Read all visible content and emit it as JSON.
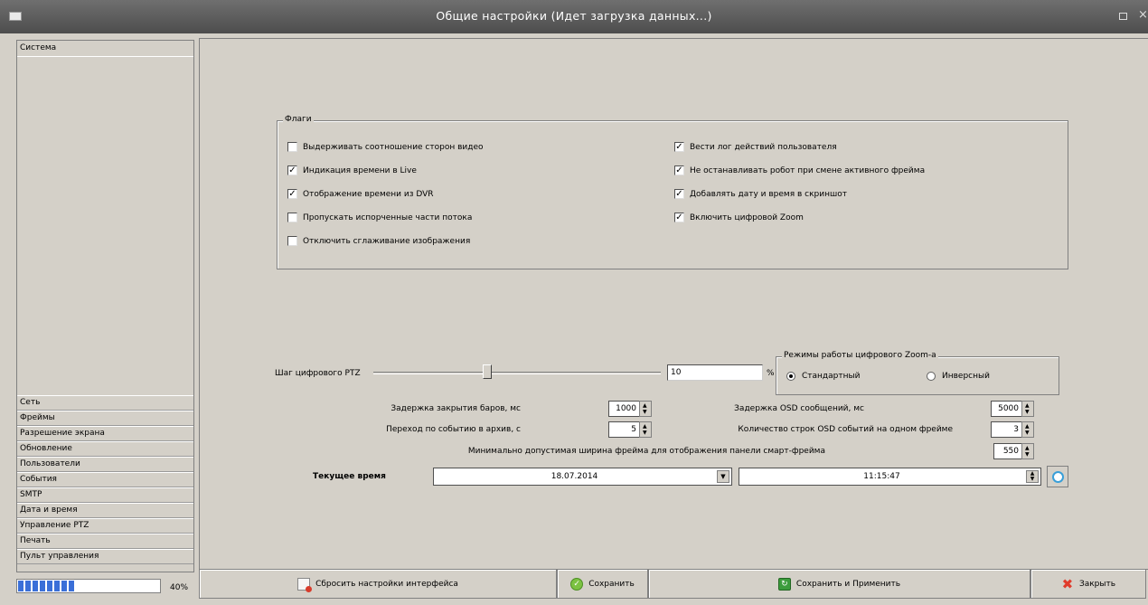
{
  "window": {
    "title": "Общие настройки (Идет загрузка данных...)"
  },
  "sidebar": {
    "active_item": "Система",
    "items": [
      "Сеть",
      "Фреймы",
      "Разрешение экрана",
      "Обновление",
      "Пользователи",
      "События",
      "SMTP",
      "Дата и время",
      "Управление PTZ",
      "Печать",
      "Пульт управления"
    ]
  },
  "progress": {
    "value": 0.4,
    "label": "40%"
  },
  "flags": {
    "legend": "Флаги",
    "left": [
      {
        "label": "Выдерживать соотношение сторон видео",
        "checked": false
      },
      {
        "label": "Индикация времени в Live",
        "checked": true
      },
      {
        "label": "Отображение времени из DVR",
        "checked": true
      },
      {
        "label": "Пропускать испорченные части потока",
        "checked": false
      },
      {
        "label": "Отключить сглаживание изображения",
        "checked": false
      }
    ],
    "right": [
      {
        "label": "Вести лог действий пользователя",
        "checked": true
      },
      {
        "label": "Не останавливать робот при смене активного фрейма",
        "checked": true
      },
      {
        "label": "Добавлять дату и время в скриншот",
        "checked": true
      },
      {
        "label": "Включить цифровой Zoom",
        "checked": true
      }
    ]
  },
  "ptz": {
    "label": "Шаг цифрового PTZ",
    "value": "10",
    "unit": "%",
    "slider_fraction": 0.38
  },
  "zoom_mode": {
    "legend": "Режимы работы цифрового Zoom-а",
    "options": [
      {
        "label": "Стандартный",
        "selected": true
      },
      {
        "label": "Инверсный",
        "selected": false
      }
    ]
  },
  "fields": {
    "bars_close_delay": {
      "label": "Задержка закрытия баров, мс",
      "value": "1000"
    },
    "osd_delay": {
      "label": "Задержка OSD  сообщений, мс",
      "value": "5000"
    },
    "archive_jump": {
      "label": "Переход по событию в архив, с",
      "value": "5"
    },
    "osd_lines": {
      "label": "Количество строк OSD событий на одном фрейме",
      "value": "3"
    },
    "min_frame_width": {
      "label": "Минимально допустимая ширина фрейма для отображения панели смарт-фрейма",
      "value": "550"
    }
  },
  "current_time": {
    "label": "Текущее время",
    "date": "18.07.2014",
    "time": "11:15:47"
  },
  "buttons": {
    "reset": "Сбросить настройки интерфейса",
    "save": "Сохранить",
    "save_apply": "Сохранить и Применить",
    "close": "Закрыть"
  },
  "icons": {
    "app": "app-icon",
    "maximize": "maximize-icon",
    "close_window": "close-icon",
    "clock": "clock-icon",
    "reset": "reset-settings-icon",
    "save": "check-icon",
    "save_apply": "apply-icon",
    "close": "close-x-icon"
  },
  "colors": {
    "titlebar": "#5a5a5a",
    "progress": "#3a6fd8",
    "close_x": "#e03c2c",
    "save_check": "#7cc242"
  }
}
